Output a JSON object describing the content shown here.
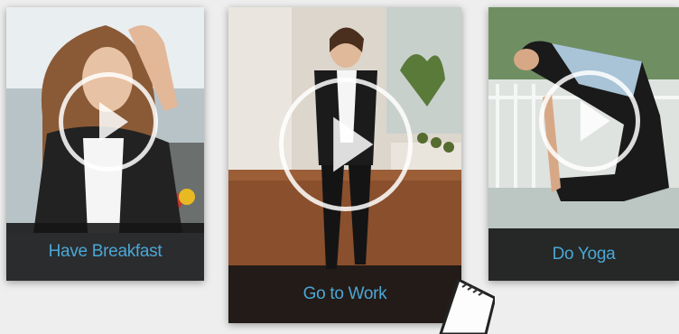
{
  "cards": [
    {
      "caption": "Have Breakfast",
      "scene": "woman-with-fruit-bowl",
      "icon": "play-icon"
    },
    {
      "caption": "Go to Work",
      "scene": "woman-in-apartment-hallway",
      "icon": "play-icon"
    },
    {
      "caption": "Do Yoga",
      "scene": "woman-in-yoga-pose",
      "icon": "play-icon"
    }
  ],
  "colors": {
    "caption_text": "#4aa7d6",
    "caption_bg": "#141416",
    "page_bg": "#eeeeee"
  }
}
